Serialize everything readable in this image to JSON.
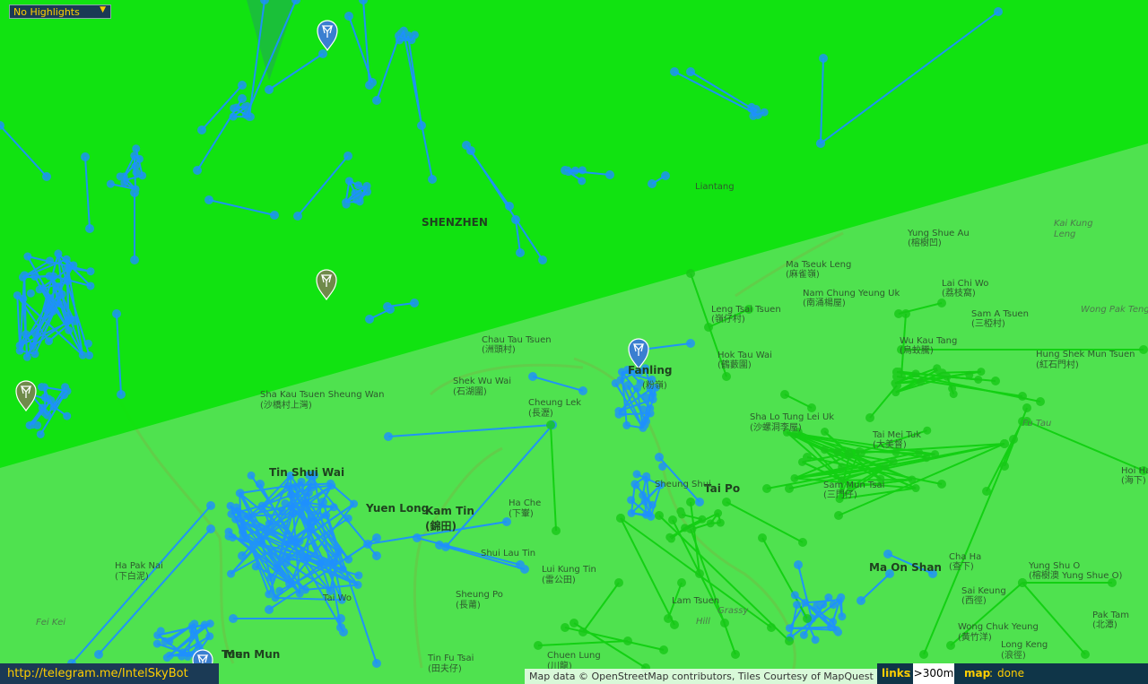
{
  "highlight_select": {
    "value": "No Highlights",
    "arrow_icon": "triangle-down-icon"
  },
  "footer": {
    "link_text": "http://telegram.me/IntelSkyBot"
  },
  "attribution": {
    "text": "Map data © OpenStreetMap contributors, Tiles Courtesy of MapQuest"
  },
  "status": {
    "links_label": "links",
    "links_value": ">300m",
    "map_label": "map",
    "map_value": "done"
  },
  "colors": {
    "base_land": "#4fe24f",
    "green_field": "#0ae30a",
    "blue_links": "#1e90ff",
    "green_links": "#10d010"
  },
  "places": [
    {
      "text": "Yung Shue Au",
      "cls": ""
    },
    {
      "text": "(榕樹凹)",
      "cls": ""
    },
    {
      "text": "Ma Tseuk Leng",
      "cls": ""
    },
    {
      "text": "(麻雀嶺)",
      "cls": ""
    },
    {
      "text": "Kai Kung",
      "cls": "it"
    },
    {
      "text": "Leng",
      "cls": "it"
    },
    {
      "text": "Lai Chi Wo",
      "cls": ""
    },
    {
      "text": "(荔枝窩)",
      "cls": ""
    },
    {
      "text": "Nam Chung Yeung Uk",
      "cls": ""
    },
    {
      "text": "(南涌楊屋)",
      "cls": ""
    },
    {
      "text": "Sam A Tsuen",
      "cls": ""
    },
    {
      "text": "(三椏村)",
      "cls": ""
    },
    {
      "text": "Wong Pak Teng",
      "cls": "it"
    },
    {
      "text": "Leng Tsai Tsuen",
      "cls": ""
    },
    {
      "text": "(嶺仔村)",
      "cls": ""
    },
    {
      "text": "Chau Tau Tsuen",
      "cls": ""
    },
    {
      "text": "(洲頭村)",
      "cls": ""
    },
    {
      "text": "Hok Tau Wai",
      "cls": ""
    },
    {
      "text": "(鶴藪圍)",
      "cls": ""
    },
    {
      "text": "Wu Kau Tang",
      "cls": ""
    },
    {
      "text": "(烏蛟騰)",
      "cls": ""
    },
    {
      "text": "Hung Shek Mun Tsuen",
      "cls": ""
    },
    {
      "text": "(紅石門村)",
      "cls": ""
    },
    {
      "text": "Shek Wu Wai",
      "cls": ""
    },
    {
      "text": "(石湖圍)",
      "cls": ""
    },
    {
      "text": "Sha Kau Tsuen Sheung Wan",
      "cls": ""
    },
    {
      "text": "(沙橋村上灣)",
      "cls": ""
    },
    {
      "text": "Cheung Lek",
      "cls": ""
    },
    {
      "text": "(長瀝)",
      "cls": ""
    },
    {
      "text": "Sha Lo Tung Lei Uk",
      "cls": ""
    },
    {
      "text": "(沙螺洞李屋)",
      "cls": ""
    },
    {
      "text": "Fu Tau",
      "cls": "it"
    },
    {
      "text": "Tai Mei Tuk",
      "cls": ""
    },
    {
      "text": "(大美督)",
      "cls": ""
    },
    {
      "text": "Tin Shui Wai",
      "cls": "big"
    },
    {
      "text": "Kam Tin",
      "cls": "big"
    },
    {
      "text": "(錦田)",
      "cls": "big"
    },
    {
      "text": "Ha Che",
      "cls": ""
    },
    {
      "text": "(下輋)",
      "cls": ""
    },
    {
      "text": "Tai Po",
      "cls": "big"
    },
    {
      "text": "Sam Mun Tsai",
      "cls": ""
    },
    {
      "text": "(三門仔)",
      "cls": ""
    },
    {
      "text": "Shui Lau Tin",
      "cls": ""
    },
    {
      "text": "Lui Kung Tin",
      "cls": ""
    },
    {
      "text": "(雷公田)",
      "cls": ""
    },
    {
      "text": "Ha Pak Nai",
      "cls": ""
    },
    {
      "text": "(下白泥)",
      "cls": ""
    },
    {
      "text": "Sheung Po",
      "cls": ""
    },
    {
      "text": "(長莆)",
      "cls": ""
    },
    {
      "text": "Ma On Shan",
      "cls": "big"
    },
    {
      "text": "Sai Keung",
      "cls": ""
    },
    {
      "text": "(西徑)",
      "cls": ""
    },
    {
      "text": "Yung Shu O",
      "cls": ""
    },
    {
      "text": "(榕樹澳 Yung Shue O)",
      "cls": ""
    },
    {
      "text": "Sheung Shui",
      "cls": ""
    },
    {
      "text": "Pak Tam",
      "cls": ""
    },
    {
      "text": "(北潭)",
      "cls": ""
    },
    {
      "text": "Wong Chuk Yeung",
      "cls": ""
    },
    {
      "text": "(黃竹洋)",
      "cls": ""
    },
    {
      "text": "Long Keng",
      "cls": ""
    },
    {
      "text": "(浪徑)",
      "cls": ""
    },
    {
      "text": "Tin Fu Tsai",
      "cls": ""
    },
    {
      "text": "(田夫仔)",
      "cls": ""
    },
    {
      "text": "Chuen Lung",
      "cls": ""
    },
    {
      "text": "(川龍)",
      "cls": ""
    },
    {
      "text": "Mun",
      "cls": "big"
    },
    {
      "text": "Fei Kei",
      "cls": "it"
    },
    {
      "text": "Hoi Ha",
      "cls": ""
    },
    {
      "text": "(海下)",
      "cls": ""
    },
    {
      "text": "Cha Ha",
      "cls": ""
    },
    {
      "text": "(查下)",
      "cls": ""
    },
    {
      "text": "Liantang",
      "cls": ""
    },
    {
      "text": "SHENZHEN",
      "cls": "big"
    },
    {
      "text": "Fanling",
      "cls": "big"
    },
    {
      "text": "(粉嶺)",
      "cls": ""
    },
    {
      "text": "Yuen Long",
      "cls": "big"
    },
    {
      "text": "Tuen Mun",
      "cls": "big"
    },
    {
      "text": "Tai Wo",
      "cls": ""
    },
    {
      "text": "Lam Tsuen",
      "cls": ""
    },
    {
      "text": "Grassy",
      "cls": "it"
    },
    {
      "text": "Hill",
      "cls": "it"
    }
  ],
  "portal_markers": [
    {
      "icon": "resistance-portal-icon",
      "color": "#3a7fd0"
    },
    {
      "icon": "neutral-portal-icon",
      "color": "#6f8a4a"
    },
    {
      "icon": "neutral-portal-icon",
      "color": "#6f8a4a"
    },
    {
      "icon": "resistance-portal-icon",
      "color": "#3a7fd0"
    },
    {
      "icon": "resistance-portal-icon",
      "color": "#3a7fd0"
    }
  ]
}
